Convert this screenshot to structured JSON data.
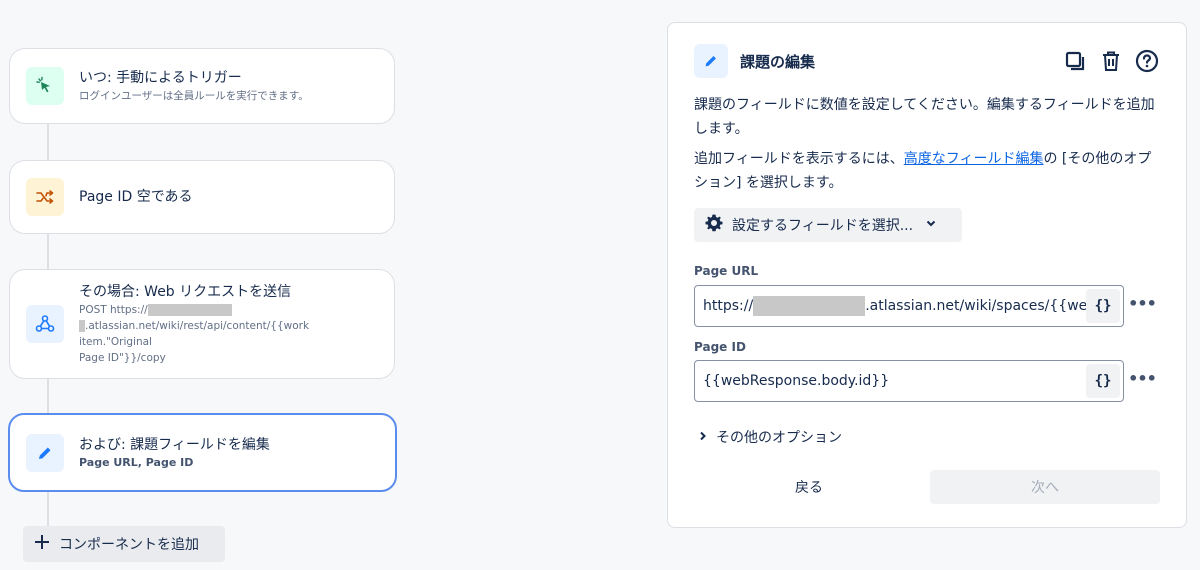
{
  "flow": {
    "trigger": {
      "title": "いつ: 手動によるトリガー",
      "subtitle": "ログインユーザーは全員ルールを実行できます。",
      "icon": "cursor-click-icon"
    },
    "condition": {
      "title": "Page ID 空である",
      "icon": "branch-shuffle-icon"
    },
    "action_web": {
      "title": "その場合: Web リクエストを送信",
      "line1": "POST https://",
      "line2": ".atlassian.net/wiki/rest/api/content/{{work item.\"Original",
      "line3": "Page ID\"}}/copy",
      "icon": "webhook-icon"
    },
    "action_edit": {
      "title": "および: 課題フィールドを編集",
      "subtitle_part1": "Page URL",
      "subtitle_sep": ", ",
      "subtitle_part2": "Page ID",
      "icon": "pencil-icon"
    },
    "add_component_label": "コンポーネントを追加"
  },
  "panel": {
    "title": "課題の編集",
    "desc1": "課題のフィールドに数値を設定してください。編集するフィールドを追加します。",
    "desc2_pre": "追加フィールドを表示するには、",
    "desc2_link": "高度なフィールド編集",
    "desc2_post": "の [その他のオプション] を選択します。",
    "select_fields_label": "設定するフィールドを選択...",
    "fields": [
      {
        "label": "Page URL",
        "value_pre": "https://",
        "value_post": ".atlassian.net/wiki/spaces/{{webRe"
      },
      {
        "label": "Page ID",
        "value": "{{webResponse.body.id}}"
      }
    ],
    "brace_label": "{}",
    "more_label": "•••",
    "more_options_label": "その他のオプション",
    "back_label": "戻る",
    "next_label": "次へ"
  },
  "colors": {
    "accent": "#0c66e4",
    "selected_border": "#5b8def"
  }
}
